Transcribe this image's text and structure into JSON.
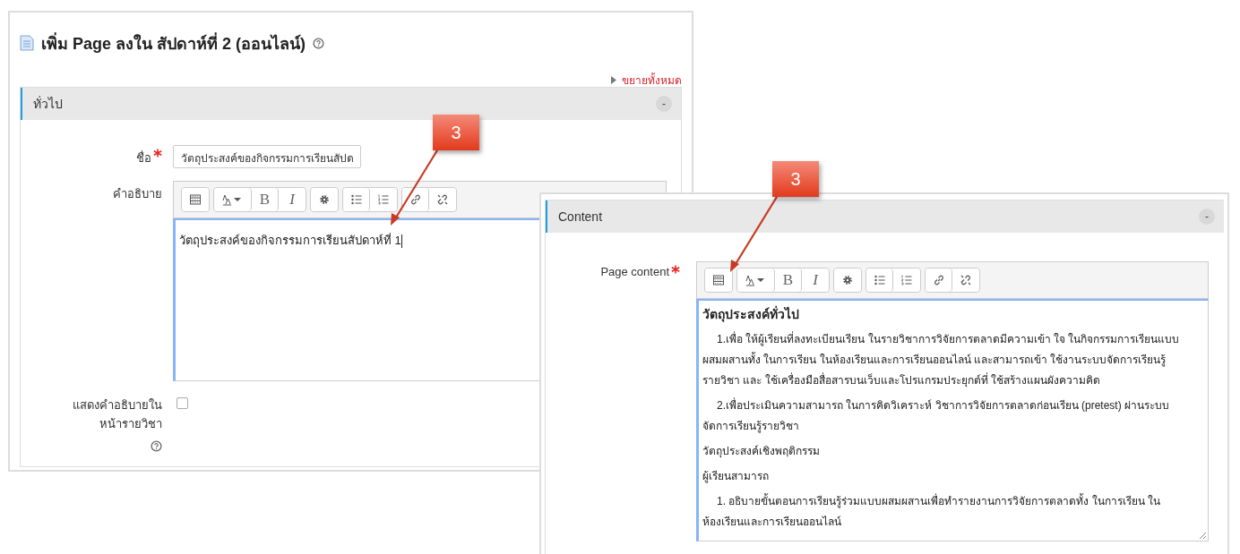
{
  "left_window": {
    "title": "เพิ่ม Page ลงใน สัปดาห์ที่ 2 (ออนไลน์)",
    "expand_all": "ขยายทั้งหมด",
    "section": {
      "title": "ทั่วไป",
      "collapse": "-"
    },
    "name_field": {
      "label": "ชื่อ",
      "value": "วัตถุประสงค์ของกิจกรรมการเรียนสัปด"
    },
    "description": {
      "label": "คำอธิบาย",
      "toolbar": {
        "bold": "B",
        "italic": "I"
      },
      "text": "วัตถุประสงค์ของกิจกรรมการเรียนสัปดาห์ที่ 1"
    },
    "show_description": {
      "label": "แสดงคำอธิบายในหน้ารายวิชา",
      "checked": false
    }
  },
  "right_window": {
    "section": {
      "title": "Content",
      "collapse": "-"
    },
    "page_content": {
      "label": "Page content",
      "toolbar": {
        "bold": "B",
        "italic": "I"
      },
      "paragraphs": [
        {
          "kind": "heading",
          "text": "วัตถุประสงค์ทั่วไป"
        },
        {
          "kind": "indented",
          "text": "1.เพื่อ ให้ผู้เรียนที่ลงทะเบียนเรียน ในรายวิชาการวิจัยการตลาดมีความเข้า ใจ ในกิจกรรมการเรียนแบบผสมผสานทั้ง ในการเรียน ในห้องเรียนและการเรียนออนไลน์ และสามารถเข้า ใช้งานระบบจัดการเรียนรู้รายวิชา และ ใช้เครื่องมือสื่อสารบนเว็บและโปรแกรมประยุกต์ที่ ใช้สร้างแผนผังความคิด"
        },
        {
          "kind": "indented",
          "text": "2.เพื่อประเมินความสามารถ ในการคิดวิเคราะห์ วิชาการวิจัยการตลาดก่อนเรียน (pretest) ผ่านระบบจัดการเรียนรู้รายวิชา"
        },
        {
          "kind": "plain",
          "text": "วัตถุประสงค์เชิงพฤติกรรม"
        },
        {
          "kind": "plain",
          "text": "ผู้เรียนสามารถ"
        },
        {
          "kind": "indented",
          "text": "1. อธิบายขั้นตอนการเรียนรู้ร่วมแบบผสมผสานเพื่อทำรายงานการวิจัยการตลาดทั้ง ในการเรียน ในห้องเรียนและการเรียนออนไลน์"
        }
      ]
    }
  },
  "callouts": [
    {
      "label": "3"
    },
    {
      "label": "3"
    }
  ]
}
